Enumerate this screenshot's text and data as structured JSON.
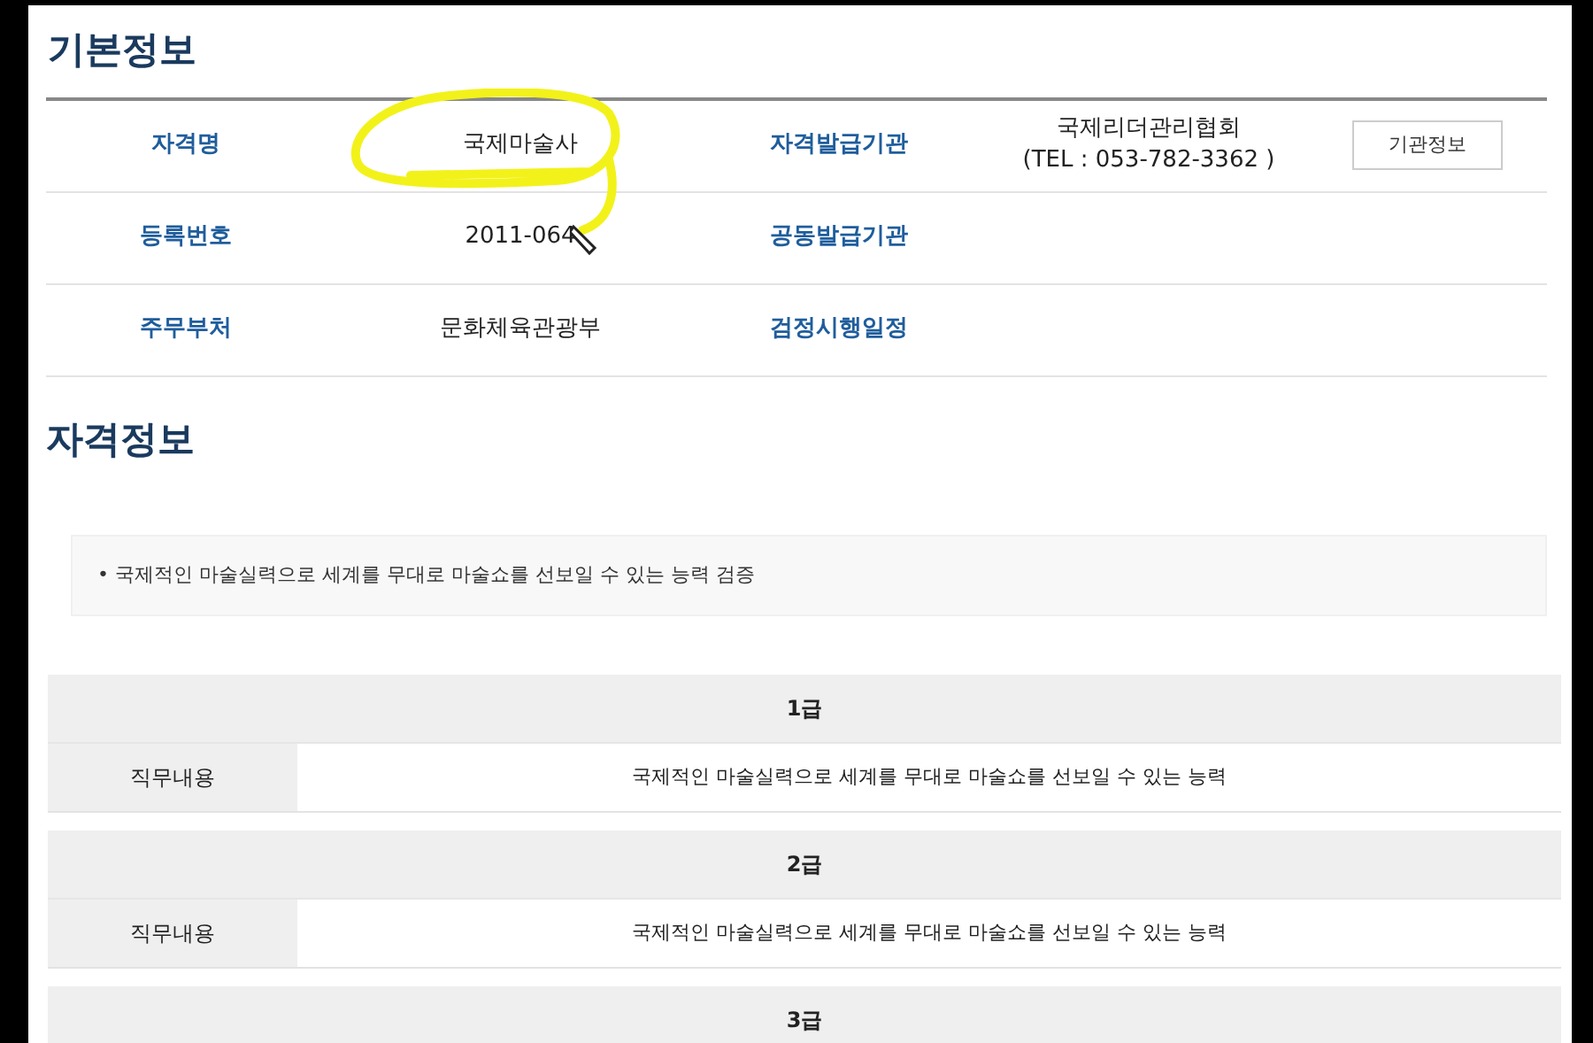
{
  "basic_info": {
    "title": "기본정보",
    "rows": [
      {
        "label_1": "자격명",
        "value_1": "국제마술사",
        "label_2": "자격발급기관",
        "value_2": [
          "국제리더관리협회",
          "(TEL : 053-782-3362 )"
        ],
        "button": "기관정보"
      },
      {
        "label_1": "등록번호",
        "value_1": "2011-064",
        "label_2": "공동발급기관"
      },
      {
        "label_1": "주무부처",
        "value_1": "문화체육관광부",
        "label_2": "검정시행일정"
      }
    ]
  },
  "qualification_info": {
    "title": "자격정보",
    "summary": "• 국제적인 마술실력으로 세계를 무대로 마술쇼를 선보일 수 있는 능력 검증",
    "grades": [
      {
        "grade": "1급",
        "label": "직무내용",
        "content": "국제적인 마술실력으로 세계를 무대로 마술쇼를 선보일 수 있는 능력"
      },
      {
        "grade": "2급",
        "label": "직무내용",
        "content": "국제적인 마술실력으로 세계를 무대로 마술쇼를 선보일 수 있는 능력"
      },
      {
        "grade": "3급"
      }
    ]
  }
}
